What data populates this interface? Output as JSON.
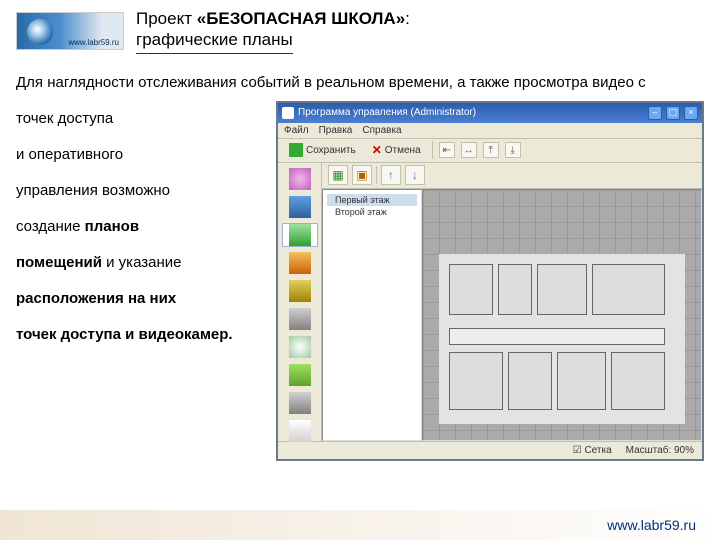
{
  "header": {
    "logo_domain": "www.labr59.ru",
    "title_line1_pre": "Проект ",
    "title_line1_bold": "«БЕЗОПАСНАЯ ШКОЛА»",
    "title_line1_post": ":",
    "title_line2": "графические планы"
  },
  "intro": "Для наглядности отслеживания событий в реальном времени, а также просмотра видео с",
  "left_lines": [
    {
      "t": "точек доступа",
      "b": false
    },
    {
      "t": "и оперативного",
      "b": false
    },
    {
      "t": "управления возможно",
      "b": false
    },
    {
      "t": "создание ",
      "b": false,
      "tb": "планов"
    },
    {
      "t": "",
      "b": false,
      "tb": "помещений",
      "post": " и указание"
    },
    {
      "t": "",
      "b": false,
      "tb": "расположения на них"
    },
    {
      "t": "",
      "b": false,
      "tb": "точек доступа и видеокамер."
    }
  ],
  "app": {
    "title": "Программа управления (Administrator)",
    "menu": [
      "Файл",
      "Правка",
      "Справка"
    ],
    "toolbar": {
      "save": "Сохранить",
      "cancel": "Отмена"
    },
    "tree": [
      "Первый этаж",
      "Второй этаж"
    ],
    "status": {
      "grid": "Сетка",
      "scale_label": "Масштаб:",
      "scale_val": "90%"
    }
  },
  "footer": {
    "url": "www.labr59.ru"
  }
}
